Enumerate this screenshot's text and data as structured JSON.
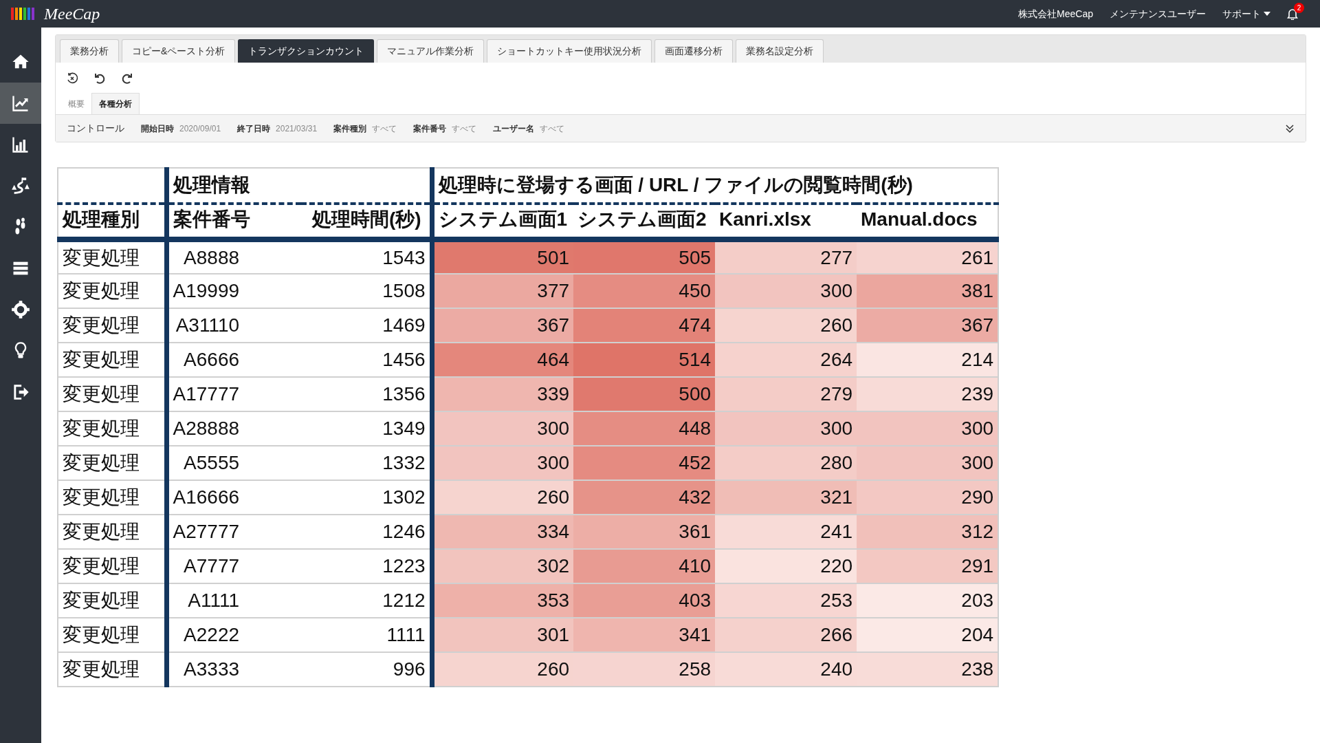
{
  "topbar": {
    "logo": "MeeCap",
    "company": "株式会社MeeCap",
    "user": "メンテナンスユーザー",
    "support": "サポート",
    "notification_count": "2"
  },
  "sidebar": {
    "items": [
      {
        "kind": "home",
        "selected": false
      },
      {
        "kind": "linechart",
        "selected": true
      },
      {
        "kind": "barchart",
        "selected": false
      },
      {
        "kind": "trail",
        "selected": false
      },
      {
        "kind": "footprints",
        "selected": false
      },
      {
        "kind": "list",
        "selected": false
      },
      {
        "kind": "gear",
        "selected": false
      },
      {
        "kind": "bulb",
        "selected": false
      },
      {
        "kind": "logout",
        "selected": false
      }
    ]
  },
  "tabs": [
    {
      "label": "業務分析",
      "selected": false
    },
    {
      "label": "コピー&ペースト分析",
      "selected": false
    },
    {
      "label": "トランザクションカウント",
      "selected": true
    },
    {
      "label": "マニュアル作業分析",
      "selected": false
    },
    {
      "label": "ショートカットキー使用状況分析",
      "selected": false
    },
    {
      "label": "画面遷移分析",
      "selected": false
    },
    {
      "label": "業務名設定分析",
      "selected": false
    }
  ],
  "subtabs": [
    {
      "label": "概要",
      "selected": false
    },
    {
      "label": "各種分析",
      "selected": true
    }
  ],
  "controls": {
    "label": "コントロール",
    "filters": [
      {
        "label": "開始日時",
        "value": "2020/09/01"
      },
      {
        "label": "終了日時",
        "value": "2021/03/31"
      },
      {
        "label": "案件種別",
        "value": "すべて"
      },
      {
        "label": "案件番号",
        "value": "すべて"
      },
      {
        "label": "ユーザー名",
        "value": "すべて"
      }
    ]
  },
  "table": {
    "groups": [
      {
        "columns": [
          "処理種別"
        ]
      },
      {
        "label": "処理情報",
        "columns": [
          "案件番号",
          "処理時間(秒)"
        ]
      },
      {
        "label": "処理時に登場する画面 / URL / ファイルの閲覧時間(秒)",
        "columns": [
          "システム画面1",
          "システム画面2",
          "Kanri.xlsx",
          "Manual.docs"
        ]
      }
    ],
    "rows": [
      {
        "type": "変更処理",
        "case": "A8888",
        "time": "1543",
        "views": [
          {
            "value": "501",
            "color": "#e0796d"
          },
          {
            "value": "505",
            "color": "#e0776c"
          },
          {
            "value": "277",
            "color": "#f4cdc8"
          },
          {
            "value": "261",
            "color": "#f6d3cf"
          }
        ]
      },
      {
        "type": "変更処理",
        "case": "A19999",
        "time": "1508",
        "views": [
          {
            "value": "377",
            "color": "#eba8a0"
          },
          {
            "value": "450",
            "color": "#e58c82"
          },
          {
            "value": "300",
            "color": "#f2c4bf"
          },
          {
            "value": "381",
            "color": "#eba69e"
          }
        ]
      },
      {
        "type": "変更処理",
        "case": "A31110",
        "time": "1469",
        "views": [
          {
            "value": "367",
            "color": "#ecaba4"
          },
          {
            "value": "474",
            "color": "#e38378"
          },
          {
            "value": "260",
            "color": "#f6d4cf"
          },
          {
            "value": "367",
            "color": "#ecaba4"
          }
        ]
      },
      {
        "type": "変更処理",
        "case": "A6666",
        "time": "1456",
        "views": [
          {
            "value": "464",
            "color": "#e4877c"
          },
          {
            "value": "514",
            "color": "#df7468"
          },
          {
            "value": "264",
            "color": "#f6d2cd"
          },
          {
            "value": "214",
            "color": "#fae5e2"
          }
        ]
      },
      {
        "type": "変更処理",
        "case": "A17777",
        "time": "1356",
        "views": [
          {
            "value": "339",
            "color": "#efb6af"
          },
          {
            "value": "500",
            "color": "#e0796e"
          },
          {
            "value": "279",
            "color": "#f4ccc7"
          },
          {
            "value": "239",
            "color": "#f8dbd7"
          }
        ]
      },
      {
        "type": "変更処理",
        "case": "A28888",
        "time": "1349",
        "views": [
          {
            "value": "300",
            "color": "#f2c4bf"
          },
          {
            "value": "448",
            "color": "#e58d83"
          },
          {
            "value": "300",
            "color": "#f2c4bf"
          },
          {
            "value": "300",
            "color": "#f2c4bf"
          }
        ]
      },
      {
        "type": "変更処理",
        "case": "A5555",
        "time": "1332",
        "views": [
          {
            "value": "300",
            "color": "#f2c4bf"
          },
          {
            "value": "452",
            "color": "#e58b81"
          },
          {
            "value": "280",
            "color": "#f4ccc7"
          },
          {
            "value": "300",
            "color": "#f2c4bf"
          }
        ]
      },
      {
        "type": "変更処理",
        "case": "A16666",
        "time": "1302",
        "views": [
          {
            "value": "260",
            "color": "#f6d4cf"
          },
          {
            "value": "432",
            "color": "#e69389"
          },
          {
            "value": "321",
            "color": "#f0bdb6"
          },
          {
            "value": "290",
            "color": "#f3c8c3"
          }
        ]
      },
      {
        "type": "変更処理",
        "case": "A27777",
        "time": "1246",
        "views": [
          {
            "value": "334",
            "color": "#efb8b1"
          },
          {
            "value": "361",
            "color": "#edaea6"
          },
          {
            "value": "241",
            "color": "#f8dbd7"
          },
          {
            "value": "312",
            "color": "#f1c0ba"
          }
        ]
      },
      {
        "type": "変更処理",
        "case": "A7777",
        "time": "1223",
        "views": [
          {
            "value": "302",
            "color": "#f2c4be"
          },
          {
            "value": "410",
            "color": "#e89b92"
          },
          {
            "value": "220",
            "color": "#fae3df"
          },
          {
            "value": "291",
            "color": "#f3c8c2"
          }
        ]
      },
      {
        "type": "変更処理",
        "case": "A1111",
        "time": "1212",
        "views": [
          {
            "value": "353",
            "color": "#eeb1a9"
          },
          {
            "value": "403",
            "color": "#e99e95"
          },
          {
            "value": "253",
            "color": "#f7d6d2"
          },
          {
            "value": "203",
            "color": "#fbe9e6"
          }
        ]
      },
      {
        "type": "変更処理",
        "case": "A2222",
        "time": "1111",
        "views": [
          {
            "value": "301",
            "color": "#f2c4be"
          },
          {
            "value": "341",
            "color": "#efb5ae"
          },
          {
            "value": "266",
            "color": "#f5d1cc"
          },
          {
            "value": "204",
            "color": "#fbe9e6"
          }
        ]
      },
      {
        "type": "変更処理",
        "case": "A3333",
        "time": "996",
        "views": [
          {
            "value": "260",
            "color": "#f6d4cf"
          },
          {
            "value": "258",
            "color": "#f6d4d0"
          },
          {
            "value": "240",
            "color": "#f8dbd7"
          },
          {
            "value": "238",
            "color": "#f8dcd8"
          }
        ]
      }
    ]
  }
}
